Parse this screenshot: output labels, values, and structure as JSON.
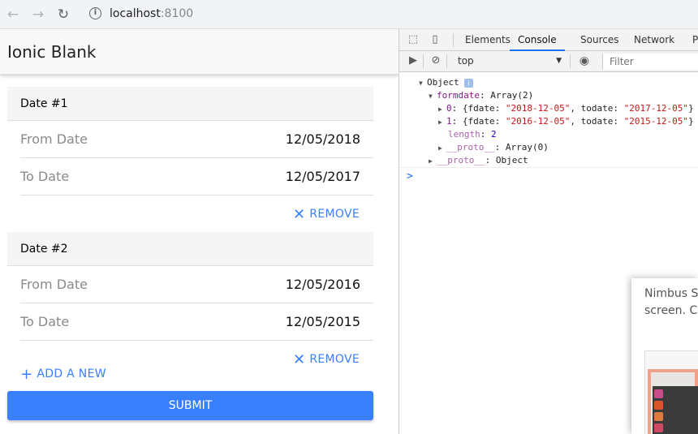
{
  "browser": {
    "back_icon": "arrow-left-icon",
    "forward_icon": "arrow-right-icon",
    "reload_icon": "reload-icon",
    "url_host": "localhost",
    "url_port": ":8100"
  },
  "app": {
    "title": "Ionic Blank",
    "dates": [
      {
        "heading": "Date #1",
        "from_label": "From Date",
        "from_value": "12/05/2018",
        "to_label": "To Date",
        "to_value": "12/05/2017",
        "remove_label": "REMOVE"
      },
      {
        "heading": "Date #2",
        "from_label": "From Date",
        "from_value": "12/05/2016",
        "to_label": "To Date",
        "to_value": "12/05/2015",
        "remove_label": "REMOVE"
      }
    ],
    "add_label": "ADD A NEW",
    "submit_label": "SUBMIT",
    "accent_color": "#3880ff"
  },
  "devtools": {
    "tabs": [
      "Elements",
      "Console",
      "Sources",
      "Network",
      "Pe"
    ],
    "active_tab": "Console",
    "context": "top",
    "filter_placeholder": "Filter",
    "console": {
      "object_label": "Object",
      "formdate_key": "formdate",
      "formdate_type": "Array(2)",
      "item0_index": "0",
      "item0_open": "{fdate: ",
      "item0_fdate": "\"2018-12-05\"",
      "item0_mid": ", todate: ",
      "item0_todate": "\"2017-12-05\"",
      "item0_close": "}",
      "item1_index": "1",
      "item1_open": "{fdate: ",
      "item1_fdate": "\"2016-12-05\"",
      "item1_mid": ", todate: ",
      "item1_todate": "\"2015-12-05\"",
      "item1_close": "}",
      "length_key": "length",
      "length_value": "2",
      "proto_key": "__proto__",
      "proto_array": "Array(0)",
      "proto_object": "Object",
      "prompt_symbol": ">"
    }
  },
  "nimbus": {
    "line1": "Nimbus Sc",
    "line2": "screen. Ch"
  }
}
